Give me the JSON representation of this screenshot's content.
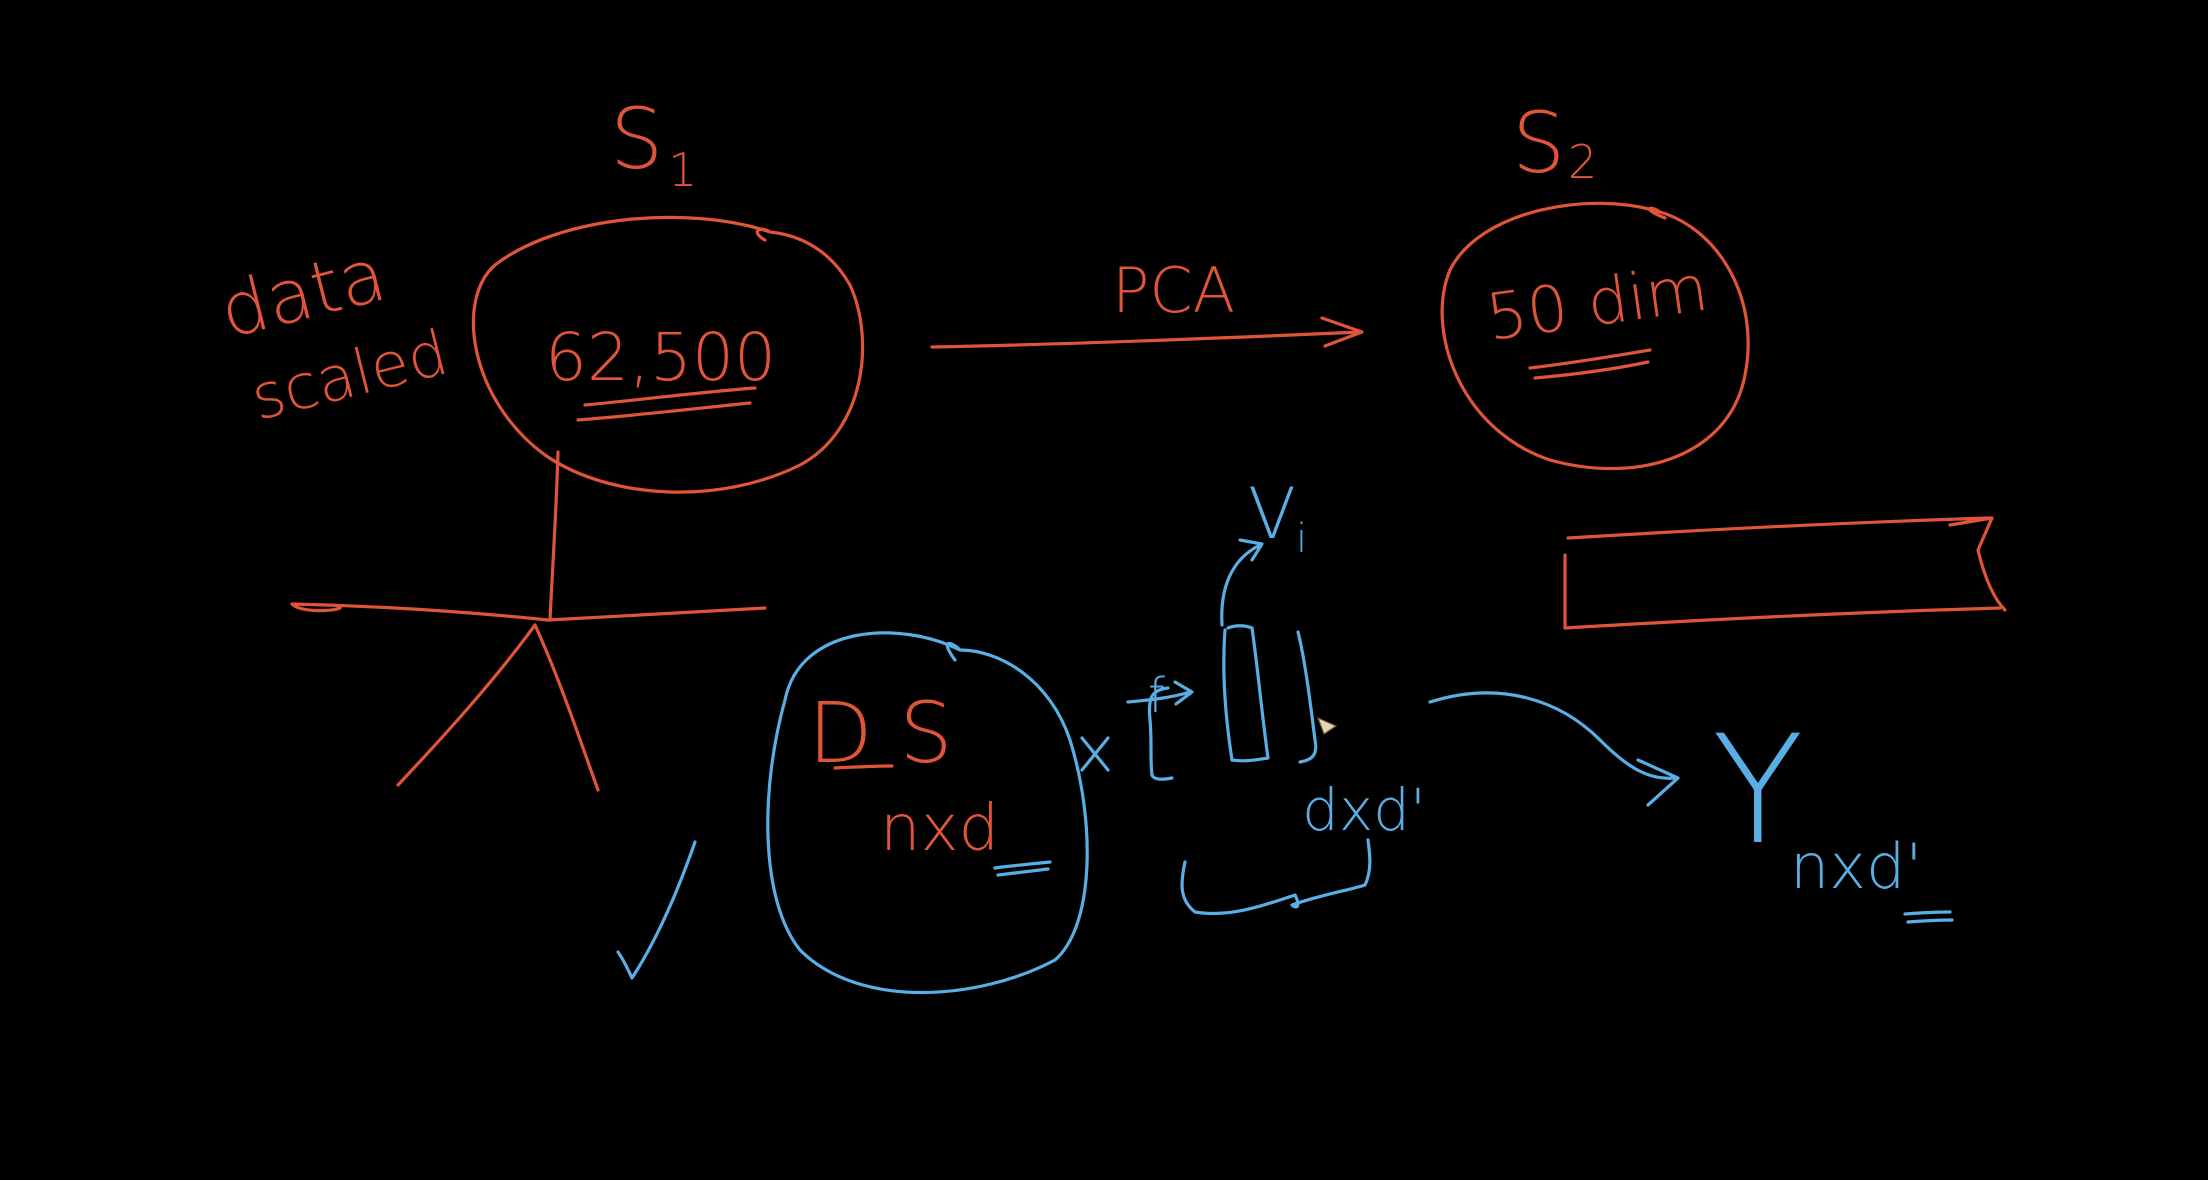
{
  "colors": {
    "background": "#000000",
    "red_ink": "#e0553a",
    "blue_ink": "#5aaee6"
  },
  "labels": {
    "s1": "S",
    "s1_sub": "1",
    "s2": "S",
    "s2_sub": "2",
    "data_line1": "data",
    "data_line2": "scaled",
    "dim_62500": "62,500",
    "pca": "PCA",
    "dim_50": "50 dim",
    "vi": "V",
    "vi_sub": "i",
    "ds": "D S",
    "nxd": "nxd",
    "x": "x",
    "f": "f",
    "dxd": "dxd'",
    "y": "Y",
    "y_sub": "nxd'"
  },
  "icons": {
    "cursor": "cursor-icon"
  }
}
